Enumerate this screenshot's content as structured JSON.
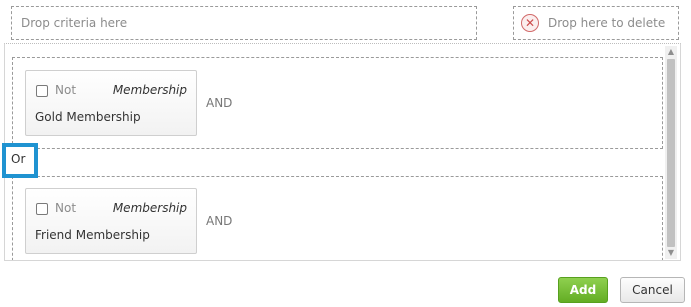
{
  "drop_criteria": {
    "placeholder": "Drop criteria here"
  },
  "delete_zone": {
    "label": "Drop here to delete",
    "icon": "close-circle-icon",
    "icon_glyph": "✕"
  },
  "groups": [
    {
      "criteria": {
        "not_label": "Not",
        "not_checked": false,
        "type": "Membership",
        "name": "Gold Membership"
      },
      "operator": "AND"
    },
    {
      "criteria": {
        "not_label": "Not",
        "not_checked": false,
        "type": "Membership",
        "name": "Friend Membership"
      },
      "operator": "AND"
    }
  ],
  "connector": "Or",
  "scrollbar": {
    "up_glyph": "▲",
    "down_glyph": "▼"
  },
  "buttons": {
    "add": "Add",
    "cancel": "Cancel"
  },
  "colors": {
    "add_button": "#63ad24",
    "or_highlight": "#1f93d1",
    "delete_icon": "#cc4b4b"
  }
}
